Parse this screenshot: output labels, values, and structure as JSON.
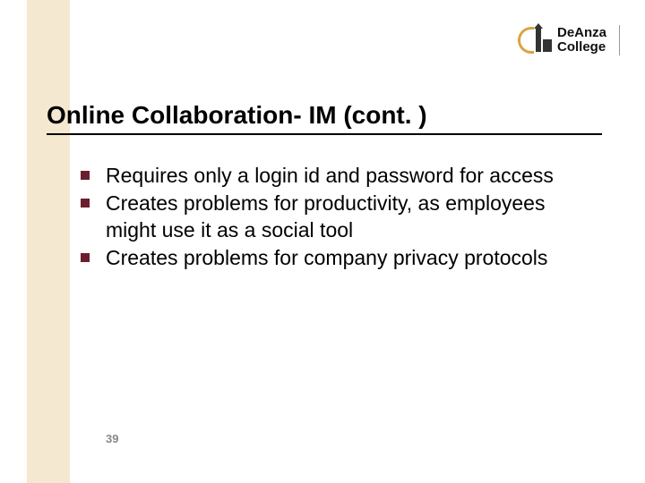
{
  "logo": {
    "line1": "DeAnza",
    "line2": "College"
  },
  "title": "Online Collaboration- IM (cont. )",
  "bullets": [
    "Requires only a login id and password for access",
    "Creates problems for productivity, as employees might use it as a social tool",
    "Creates problems for company privacy protocols"
  ],
  "page_number": "39"
}
